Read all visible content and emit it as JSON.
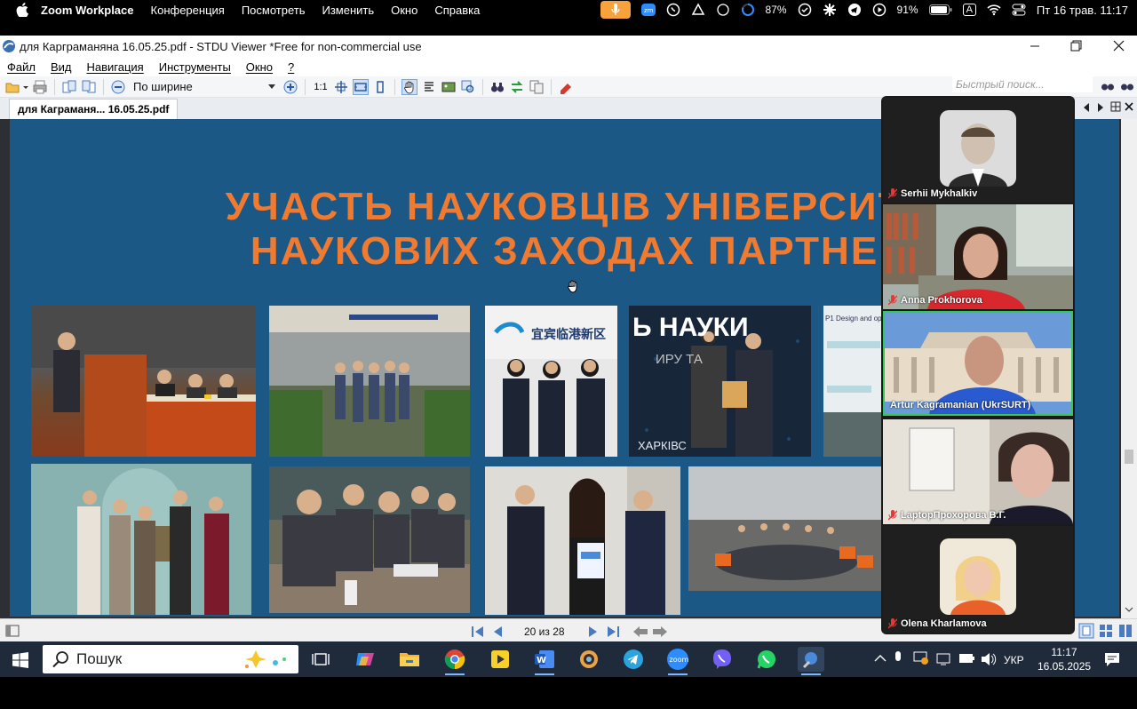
{
  "mac_menu": {
    "app_name": "Zoom Workplace",
    "items": [
      "Конференция",
      "Посмотреть",
      "Изменить",
      "Окно",
      "Справка"
    ],
    "battery_percent": "87%",
    "battery2_percent": "91%",
    "input_lang": "A",
    "datetime": "Пт 16 трав.  11:17"
  },
  "viewer": {
    "title": "для Карграманяна   16.05.25.pdf - STDU Viewer *Free for non-commercial use",
    "menu": [
      "Файл",
      "Вид",
      "Навигация",
      "Инструменты",
      "Окно",
      "?"
    ],
    "zoom_mode": "По ширине",
    "actual_size_label": "1:1",
    "search_placeholder": "Быстрый поиск...",
    "tab_label": "для Каграманя... 16.05.25.pdf",
    "page_indicator": "20 из 28"
  },
  "slide": {
    "headline_line1": "УЧАСТЬ НАУКОВЦІВ УНІВЕРСИТ",
    "headline_line2": "НАУКОВИХ ЗАХОДАХ ПАРТНЕ",
    "photo3_sign": "宜宾临港新区",
    "photo4_banner": "Ь НАУКИ",
    "photo4_sub": "ИРУ ТА",
    "photo4_footer": "ХАРКІВС",
    "photo5_text": "P1 Design and opt"
  },
  "participants": [
    {
      "name": "Serhii Mykhalkiv",
      "muted": true
    },
    {
      "name": "Anna Prokhorova",
      "muted": true
    },
    {
      "name": "Artur Kagramanian (UkrSURT)",
      "muted": false,
      "active": true
    },
    {
      "name": "LaptopПрохорова В.Г.",
      "muted": true
    },
    {
      "name": "Olena Kharlamova",
      "muted": true
    }
  ],
  "taskbar": {
    "search_label": "Пошук",
    "lang": "УКР",
    "time": "11:17",
    "date": "16.05.2025"
  },
  "colors": {
    "slide_bg": "#1c5885",
    "headline": "#f07a2f",
    "active_speaker": "#35c759"
  }
}
